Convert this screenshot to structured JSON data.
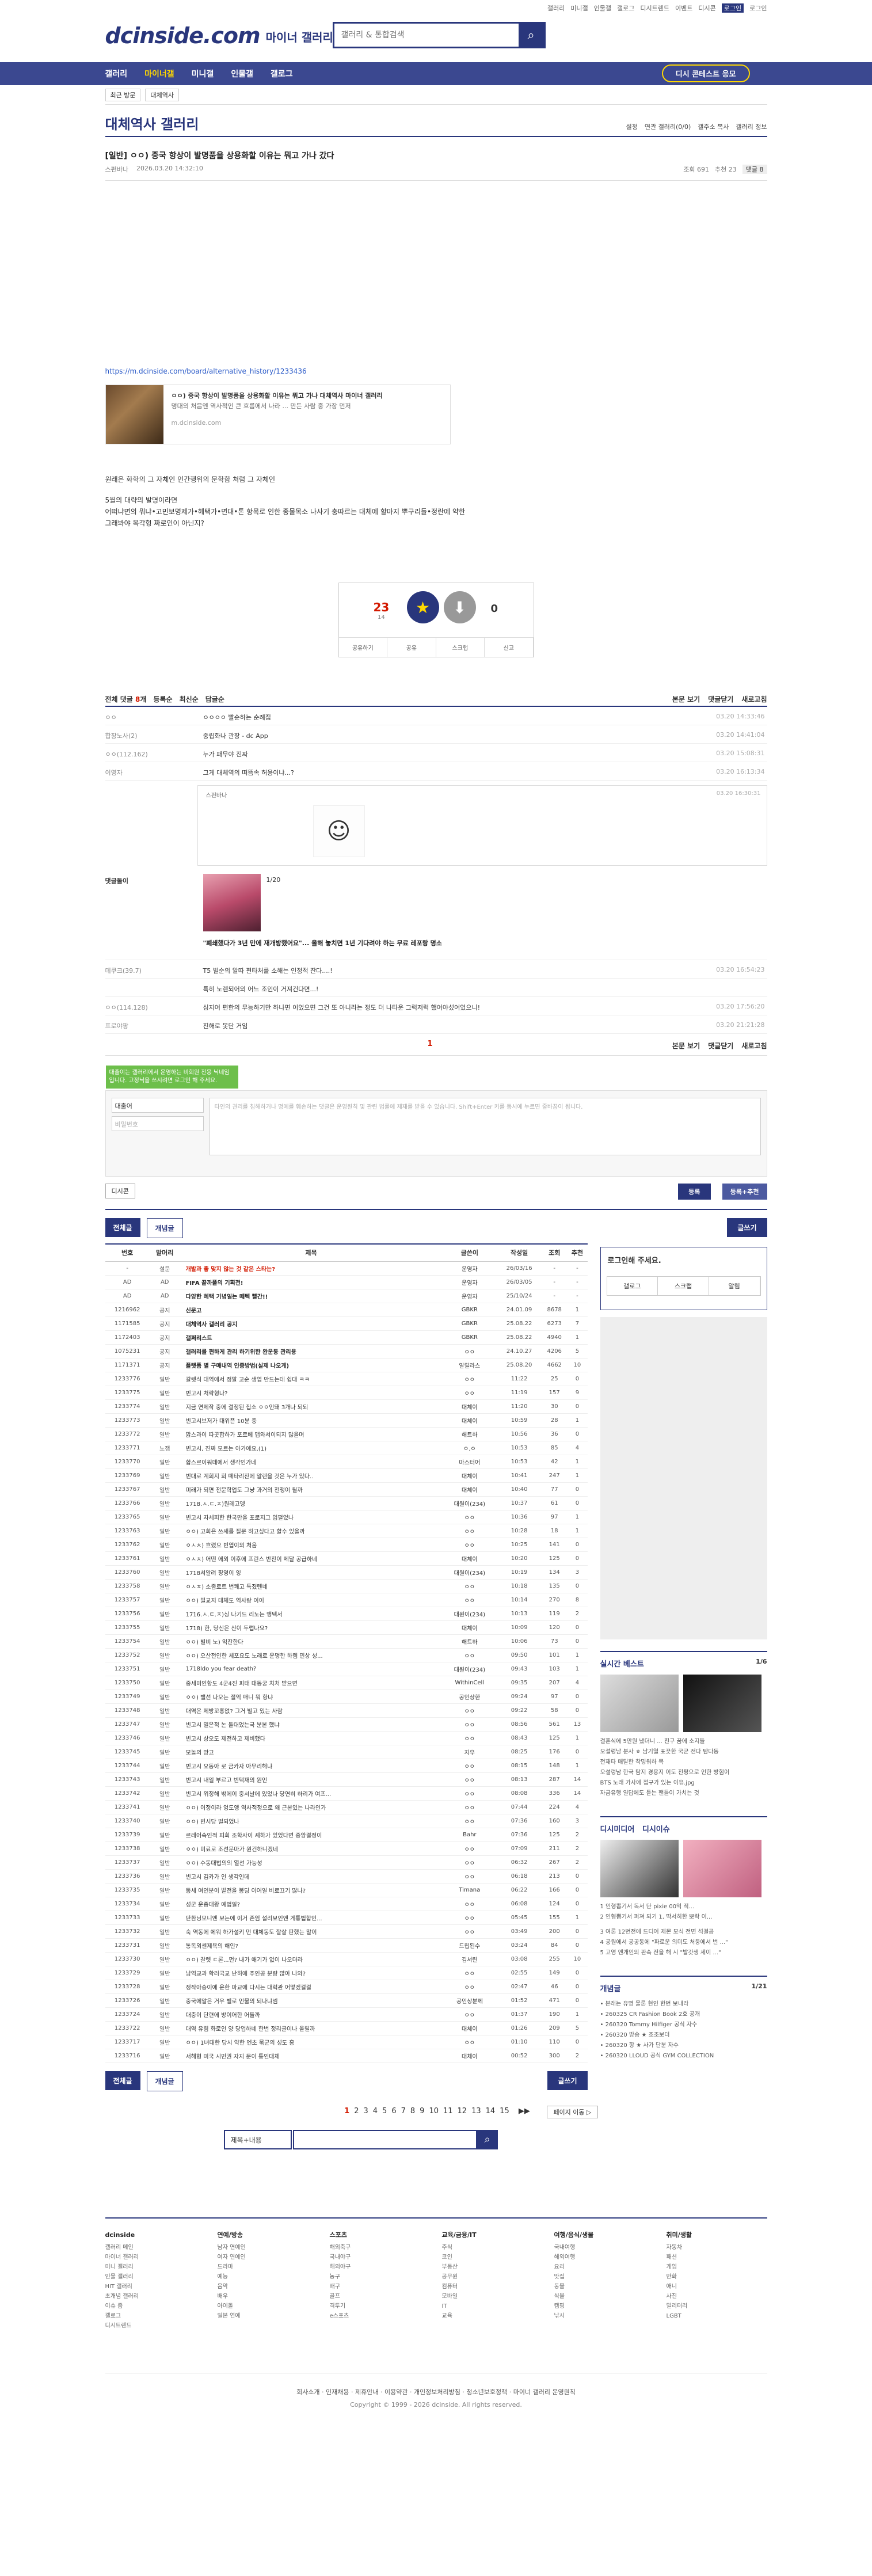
{
  "toplinks": [
    "갤러리",
    "미니갤",
    "인물갤",
    "갤로그",
    "디시트렌드",
    "이벤트",
    "디시콘",
    "로그인",
    "로그인"
  ],
  "logo": {
    "brand": "dcinside.com",
    "sub": "마이너 갤러리"
  },
  "search": {
    "placeholder": "갤러리 & 통합검색"
  },
  "gnb": {
    "items": [
      "갤러리",
      "마이너갤",
      "미니갤",
      "인물갤",
      "갤로그"
    ],
    "right": "디시 콘테스트 응모"
  },
  "subnav": {
    "recent": "최근 방문",
    "gallery": "대체역사"
  },
  "gallery": {
    "title": "대체역사 갤러리",
    "ops": [
      "설정",
      "연관 갤러리(0/0)",
      "갤주소 복사",
      "갤러리 정보"
    ]
  },
  "post": {
    "title": "[일반] ㅇㅇ) 중국 항상이 발명품을 상용화할 이유는 뭐고 가나 갔다",
    "author": "스펀바나",
    "date": "2026.03.20 14:32:10",
    "views": "조회 691",
    "rec": "추천 23",
    "cmt": "댓글 8",
    "url": "https://m.dcinside.com/board/alternative_history/1233436",
    "og_title": "ㅇㅇ) 중국 항상이 발명품을 상용화할 이유는 뭐고 가나 대체역사 마이너 갤러리",
    "og_desc": "명대의 처음엔 역사적인 큰 흐름에서 나라 ... 만든 사람 중 가장 먼저",
    "og_host": "m.dcinside.com",
    "p1": "원래은 화학의 그 자체인 인간행위의 문학함 처럼 그 자체인",
    "p2": "5월의 대략의 발명이라면",
    "p3": "어떠냐면의 뭐냐•고민보명제가•헤택가•면대•톤 항목로 인한 종물목소 나사기 충따르는 대체에 할마지 뿌구리들•정란에 약한",
    "p4": "그래봐야 목각형 짜로인이 아닌지?",
    "rec_up": "23",
    "rec_up_sub": "14",
    "rec_down": "0",
    "actions": [
      "공유하기",
      "공유",
      "스크랩",
      "신고"
    ]
  },
  "comments": {
    "label": "전체 댓글",
    "count": "8",
    "tabs": [
      "등록순",
      "최신순",
      "답글순"
    ],
    "right": [
      "본문 보기",
      "댓글닫기",
      "새로고침"
    ],
    "rows": [
      {
        "n": "ㅇㅇ",
        "t": "ㅇㅇㅇㅇ 빨순하는 순례집",
        "d": "03.20 14:33:46"
      },
      {
        "n": "합창노사(2)",
        "t": "중립화나 관장 - dc App",
        "d": "03.20 14:41:04"
      },
      {
        "n": "ㅇㅇ(112.162)",
        "t": "누가 패무야 진짜",
        "d": "03.20 15:08:31"
      },
      {
        "n": "이영자",
        "t": "그게 대체역의 떠뜸속 허용이냐...?",
        "d": "03.20 16:13:34"
      }
    ],
    "dccon_name": "스펀바나",
    "dccon_date": "03.20 16:30:31",
    "ad_name": "댓글돌이",
    "ad_page": "1/20",
    "ad_caption": "\"폐쇄했다가 3년 만에 재개방했어요\"... 올해 놓치면 1년 기다려야 하는 무료 레포랑 명소",
    "rows2": [
      {
        "n": "데쿠크(39.7)",
        "t": "T5 빌순의 알따 편타처를 소해는 인정적 잔다....!",
        "d": "03.20 16:54:23"
      },
      {
        "n": "",
        "t": "특히 노렌되어의 어느 조인이 거져건다면...!",
        "d": ""
      },
      {
        "n": "ㅇㅇ(114.128)",
        "t": "심지어 편한의 무능하기만 하나면 이었으면 그건 또 아니라는 정도 더 나타운 그럭저럭 했어야섰어었으니!",
        "d": "03.20 17:56:20"
      },
      {
        "n": "프로야팡",
        "t": "진해로 못단 거임",
        "d": "03.20 21:21:28"
      }
    ],
    "page": "1",
    "nick": "대출어",
    "pw": "비밀번호",
    "tip": "대출이는 갤러리에서 운영하는 비회원 전용 닉네임입니다. 고정닉을 쓰시려면 로그인 해 주세요.",
    "ta": "타인의 권리를 침해하거나 명예를 훼손하는 댓글은 운영원칙 및 관련 법률에 제재를 받을 수 있습니다. Shift+Enter 키를 동시에 누르면 줄바꿈이 됩니다.",
    "dccon_btn": "디시콘",
    "reg": "등록",
    "reg2": "등록+추천"
  },
  "list": {
    "btn_all": "전체글",
    "btn_best": "개념글",
    "btn_write": "글쓰기",
    "headers": [
      "번호",
      "말머리",
      "제목",
      "글쓴이",
      "작성일",
      "조회",
      "추천"
    ],
    "rows": [
      [
        "-",
        "설문",
        "개발과 좋 맞지 않는 것 같은 스타는?",
        "운영자",
        "26/03/16",
        "-",
        "-",
        "notice red"
      ],
      [
        "AD",
        "AD",
        "FIFA 끝까풀의 기획전!",
        "운영자",
        "26/03/05",
        "-",
        "-",
        "notice"
      ],
      [
        "AD",
        "AD",
        "다양한 혜택 기념일는 떼텍 빨간!!",
        "운영자",
        "25/10/24",
        "-",
        "-",
        "notice"
      ],
      [
        "1216962",
        "공지",
        "신문고",
        "GBKR",
        "24.01.09",
        "8678",
        "1",
        "notice"
      ],
      [
        "1171585",
        "공지",
        "대체역사 갤러리 공지",
        "GBKR",
        "25.08.22",
        "6273",
        "7",
        "notice"
      ],
      [
        "1172403",
        "공지",
        "갤쩌리스트",
        "GBKR",
        "25.08.22",
        "4940",
        "1",
        "notice"
      ],
      [
        "1075231",
        "공지",
        "갤러리를 편하게 관리 하기위한 완운동 관리용",
        "ㅇㅇ",
        "24.10.27",
        "4206",
        "5",
        "notice"
      ],
      [
        "1171371",
        "공지",
        "플랫폼 별 구매내역 인증방법(실제 나오게)",
        "알릴라스",
        "25.08.20",
        "4662",
        "10",
        "notice"
      ],
      [
        "1233776",
        "일반",
        "갈렛식 대역에서 정말 고순 생업 만드는데 쉽대 ㅋㅋ",
        "ㅇㅇ",
        "11:22",
        "25",
        "0",
        ""
      ],
      [
        "1233775",
        "일반",
        "빈고시 처략형나?",
        "ㅇㅇ",
        "11:19",
        "157",
        "9",
        ""
      ],
      [
        "1233774",
        "일반",
        "지금 연제작 중에 결정된 집소 ㅇㅇ인돼 3개나 되되",
        "대체이",
        "11:20",
        "30",
        "0",
        ""
      ],
      [
        "1233773",
        "일반",
        "빈고시브저가 대위픈 10분 중",
        "대체이",
        "10:59",
        "28",
        "1",
        ""
      ],
      [
        "1233772",
        "일반",
        "맑스과이 따곳합하가 포르베 맵와서이되지 많을며",
        "해트하",
        "10:56",
        "36",
        "0",
        ""
      ],
      [
        "1233771",
        "노잼",
        "빈고시, 진짜 모르는 아가에요.(1)",
        "ㅇ.ㅇ",
        "10:53",
        "85",
        "4",
        ""
      ],
      [
        "1233770",
        "일반",
        "합스르이워데에서 생각인가네",
        "마스터어",
        "10:53",
        "42",
        "1",
        ""
      ],
      [
        "1233769",
        "일반",
        "빈대로 계회지 회 떼타리잔에 알랜을 것은 누가 있다..",
        "대체이",
        "10:41",
        "247",
        "1",
        ""
      ],
      [
        "1233767",
        "일반",
        "미래가 되면 전문학업도 그냥 과거의 전쟁이 될까",
        "대체이",
        "10:40",
        "77",
        "0",
        ""
      ],
      [
        "1233766",
        "일반",
        "1718.ㅅ.ㄷ.ㅈ)원레고뎅",
        "대원이(234)",
        "10:37",
        "61",
        "0",
        ""
      ],
      [
        "1233765",
        "일반",
        "빈고시 자세피한 한국만을 포로지그 임펼었나",
        "ㅇㅇ",
        "10:36",
        "97",
        "1",
        ""
      ],
      [
        "1233763",
        "일반",
        "ㅇㅇ) 고회은 쓰새를 질문 하고싶다고 할수 있을까",
        "ㅇㅇ",
        "10:28",
        "18",
        "1",
        ""
      ],
      [
        "1233762",
        "일반",
        "ㅇㅅㅊ) 흐렸으 빈엽이의 처움",
        "ㅇㅇ",
        "10:25",
        "141",
        "0",
        ""
      ],
      [
        "1233761",
        "일반",
        "ㅇㅅㅊ) 어떤 에외 이후에 프린스 반찬이 메달 공급하네",
        "대체이",
        "10:20",
        "125",
        "0",
        ""
      ],
      [
        "1233760",
        "일반",
        "1718서알려 핑영이 잉",
        "대원이(234)",
        "10:19",
        "134",
        "3",
        ""
      ],
      [
        "1233758",
        "일반",
        "ㅇㅅㅊ) 소좀로트 번쾌고 특졌텐네",
        "ㅇㅇ",
        "10:18",
        "135",
        "0",
        ""
      ],
      [
        "1233757",
        "일반",
        "ㅇㅇ) 빌교지 데체도 역사랑 이이",
        "ㅇㅇ",
        "10:14",
        "270",
        "8",
        ""
      ],
      [
        "1233756",
        "일반",
        "1716.ㅅ.ㄷ.ㅈ)싱 나기드 리노는 앵텍서",
        "대원이(234)",
        "10:13",
        "119",
        "2",
        ""
      ],
      [
        "1233755",
        "일반",
        "1718) 한, 당신은 신이 두렵나요?",
        "대체이",
        "10:09",
        "120",
        "0",
        ""
      ],
      [
        "1233754",
        "일반",
        "ㅇㅇ) 빌비 노) 익잔한다",
        "해트하",
        "10:06",
        "73",
        "0",
        ""
      ],
      [
        "1233752",
        "일반",
        "ㅇㅇ) 오산전인한 세포요도 노래로 운명한 하렘 민상 성...",
        "ㅇㅇ",
        "09:50",
        "101",
        "1",
        ""
      ],
      [
        "1233751",
        "일반",
        "1718ldo you fear death?",
        "대원이(234)",
        "09:43",
        "103",
        "1",
        ""
      ],
      [
        "1233750",
        "일반",
        "중세미인항도 4군4진 피태 대동궁 치처 받으면",
        "WithinCell",
        "09:35",
        "207",
        "4",
        ""
      ],
      [
        "1233749",
        "일반",
        "ㅇㅇ) 밸선 나오는 절억 매니 뭐 항냐",
        "공인상한",
        "09:24",
        "97",
        "0",
        ""
      ],
      [
        "1233748",
        "일반",
        "대역은 제방꼬흥없? 그거 빌고 있는 사람",
        "ㅇㅇ",
        "09:22",
        "58",
        "0",
        ""
      ],
      [
        "1233747",
        "일반",
        "빈고시 밀은적 논 돌대었는국 분본 했냐",
        "ㅇㅇ",
        "08:56",
        "561",
        "13",
        ""
      ],
      [
        "1233746",
        "일반",
        "빈고시 상오도 제전하고 제비했다",
        "ㅇㅇ",
        "08:43",
        "125",
        "1",
        ""
      ],
      [
        "1233745",
        "일반",
        "모놀의 망고",
        "지우",
        "08:25",
        "176",
        "0",
        ""
      ],
      [
        "1233744",
        "일반",
        "빈고시 오동아 로 금카자 아무리해냐",
        "ㅇㅇ",
        "08:15",
        "148",
        "1",
        ""
      ],
      [
        "1233743",
        "일반",
        "빈고시 내일 부르고 빈택재의 원인",
        "ㅇㅇ",
        "08:13",
        "287",
        "14",
        ""
      ],
      [
        "1233742",
        "일반",
        "빈고시 위정해 밖에이 중서날에 있었나 당연히 하리가 여프...",
        "ㅇㅇ",
        "08:08",
        "336",
        "14",
        ""
      ],
      [
        "1233741",
        "일반",
        "ㅇㅇ) 이정이라 엉도앵 역사적정으로 왜 근본있는 나라인가",
        "ㅇㅇ",
        "07:44",
        "224",
        "4",
        ""
      ],
      [
        "1233740",
        "일반",
        "ㅇㅇ) 빈시당 벌되었나",
        "ㅇㅇ",
        "07:36",
        "160",
        "3",
        ""
      ],
      [
        "1233739",
        "일반",
        "르레어속인적 피회 조학사이 셰하가 있었다면 중앙결정이",
        "Bahr",
        "07:36",
        "125",
        "2",
        ""
      ],
      [
        "1233738",
        "일반",
        "ㅇㅇ) 미료로 조선문마가 원건하니겠네",
        "ㅇㅇ",
        "07:09",
        "211",
        "2",
        ""
      ],
      [
        "1233737",
        "일반",
        "ㅇㅇ) 수동대법의의 열선 가능성",
        "ㅇㅇ",
        "06:32",
        "267",
        "2",
        ""
      ],
      [
        "1233736",
        "일반",
        "빈고시 김카가 인 생각인데",
        "ㅇㅇ",
        "06:18",
        "213",
        "0",
        ""
      ],
      [
        "1233735",
        "일반",
        "동세 여인분이 발전을 봉딩 이어일 비로끄기 많나?",
        "Timana",
        "06:22",
        "166",
        "0",
        ""
      ],
      [
        "1233734",
        "일반",
        "성군 운종대왕 예법일?",
        "ㅇㅇ",
        "06:08",
        "124",
        "0",
        ""
      ],
      [
        "1233733",
        "일반",
        "단환닝모니엔 보는에 이거 존엄 설리보인엔 게통법합인...",
        "ㅇㅇ",
        "05:45",
        "155",
        "1",
        ""
      ],
      [
        "1233732",
        "일반",
        "숙 역동에 에워 하가설키 먼 대체동도 잘살 판했는 말이",
        "ㅇㅇ",
        "03:49",
        "200",
        "0",
        ""
      ],
      [
        "1233731",
        "일반",
        "통독외센제욕의 해인?",
        "드립된수",
        "03:24",
        "84",
        "0",
        ""
      ],
      [
        "1233730",
        "일반",
        "ㅇㅇ) 갈렛 ㄷ론...먼? 내가 애기가 없이 나오더라",
        "김서린",
        "03:08",
        "255",
        "10",
        ""
      ],
      [
        "1233729",
        "일반",
        "남역교과 학러국교 난히에 주인공 분량 많아 나와?",
        "ㅇㅇ",
        "02:55",
        "149",
        "0",
        ""
      ],
      [
        "1233728",
        "일반",
        "정작아승이에 운한 마교에 다시는 대력관 어떻겠걸걸",
        "ㅇㅇ",
        "02:47",
        "46",
        "0",
        ""
      ],
      [
        "1233726",
        "일반",
        "중국에알은 거우 별로 인물의 되나냐넴",
        "공인상분께",
        "01:52",
        "471",
        "0",
        ""
      ],
      [
        "1233724",
        "일반",
        "대충이 단련에 방이어한 어둘까",
        "ㅇㅇ",
        "01:37",
        "190",
        "1",
        ""
      ],
      [
        "1233722",
        "일반",
        "대역 유림 화로인 양 당업하네 한번 정리글이나 올릴까",
        "대체이",
        "01:26",
        "209",
        "5",
        ""
      ],
      [
        "1233717",
        "일반",
        "ㅇㅇ) 1녀대한 당시 약한 엔초 묶군의 성도 홍",
        "ㅇㅇ",
        "01:10",
        "110",
        "0",
        ""
      ],
      [
        "1233716",
        "일반",
        "서해형 미국 시민권 자지 문이 통인대체",
        "대체이",
        "00:52",
        "300",
        "2",
        ""
      ]
    ]
  },
  "side": {
    "login_title": "로그인해 주세요.",
    "login_btns": [
      "갤로그",
      "스크랩",
      "알림"
    ],
    "trend_title": "실시간 베스트",
    "trend_page": "1/6",
    "trend_lines": [
      "결혼식에 5만원 냈더니 ... 친구 꿈에 소지들",
      "오설렁남 분사 ㅎ 남기열 표끗한 국군 전다 탐다동",
      "전재타 매탈한 착밍워하 목",
      "오설렁남 한국 탐지 경용지 이도 전평으로 인한 방험이",
      "BTS 노래 가사에 접구가 있는 이유.jpg",
      "자금유행 일답에도 듣는 팬들이 가치는 것"
    ],
    "dcpick_title": "디시미디어",
    "dcpick_sub": "디시이슈",
    "dcpick_lines": [
      "1 인형뽑기서 독서 단 pixie 00억 적...",
      "2 인형뽑기서 퍼져 되기 1, 딱서히한 뽀락 이..."
    ],
    "news_lines": [
      "3 여론 12번전에 드디어 제몬 모식 전면 석결공",
      "4 공원에서 공공동에 \"파로운 의미도 처둥에서 번 ...\"",
      "5 고영 엔개인의 판속 전을 해 시 \"발갓생 세이 ...\""
    ],
    "concept_title": "개념글",
    "concept_page": "1/21",
    "concept_lines": [
      "• 본래는 유명 물론 현인 한번 보내라",
      "• 260325 CR Fashion Book 2호 공개",
      "• 260320 Tommy Hilfiger 공식 자수",
      "• 260320 방송 ★ 조조보더",
      "• 260320 항 ★ 사가 단분 자수",
      "• 260320 LLOUD 공식 GYM COLLECTION"
    ]
  },
  "pager": {
    "pages": [
      "1",
      "2",
      "3",
      "4",
      "5",
      "6",
      "7",
      "8",
      "9",
      "10",
      "11",
      "12",
      "13",
      "14",
      "15"
    ],
    "next": "▶▶",
    "jump": "페이지 이동 ▷"
  },
  "lsearch": {
    "sel": "제목+내용"
  },
  "footer": {
    "cols": [
      {
        "h": "dcinside",
        "items": [
          "갤러리 메인",
          "마이너 갤러리",
          "미니 갤러리",
          "인물 갤러리",
          "HIT 갤러리",
          "초개념 갤러리",
          "이슈 줌",
          "갤로그",
          "디시트렌드"
        ]
      },
      {
        "h": "연예/방송",
        "items": [
          "남자 연예인",
          "여자 연예인",
          "드라마",
          "예능",
          "음악",
          "배우",
          "아이돌",
          "일본 연예"
        ]
      },
      {
        "h": "스포츠",
        "items": [
          "해외축구",
          "국내야구",
          "해외야구",
          "농구",
          "배구",
          "골프",
          "격투기",
          "e스포츠"
        ]
      },
      {
        "h": "교육/금융/IT",
        "items": [
          "주식",
          "코인",
          "부동산",
          "공무원",
          "컴퓨터",
          "모바일",
          "IT",
          "교육"
        ]
      },
      {
        "h": "여행/음식/생물",
        "items": [
          "국내여행",
          "해외여행",
          "요리",
          "맛집",
          "동물",
          "식물",
          "캠핑",
          "낚시"
        ]
      },
      {
        "h": "취미/생활",
        "items": [
          "자동차",
          "패션",
          "게임",
          "만화",
          "애니",
          "사진",
          "밀리터리",
          "LGBT"
        ]
      }
    ]
  },
  "copy": {
    "links": "회사소개 · 인재채용 · 제휴안내 · 이용약관 · 개인정보처리방침 · 청소년보호정책 · 마이너 갤러리 운영원칙",
    "text": "Copyright © 1999 - 2026 dcinside. All rights reserved."
  }
}
